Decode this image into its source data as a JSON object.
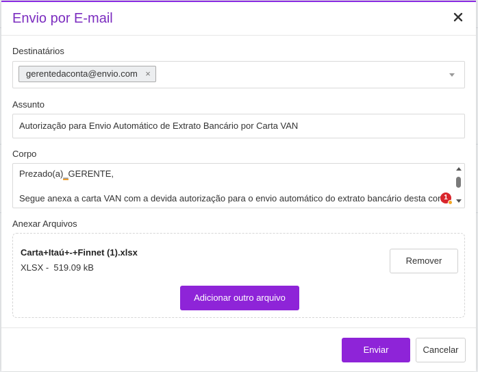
{
  "modal": {
    "title": "Envio por E-mail",
    "close_icon": "close-icon"
  },
  "recipients": {
    "label": "Destinatários",
    "tags": [
      {
        "email": "gerentedaconta@envio.com",
        "remove": "×"
      }
    ],
    "dropdown_icon": "chevron-down-icon"
  },
  "subject": {
    "label": "Assunto",
    "value": "Autorização para Envio Automático de Extrato Bancário por Carta VAN"
  },
  "body": {
    "label": "Corpo",
    "greeting_prefix": "Prezado(a)",
    "greeting_mark": "_",
    "greeting_suffix": "GERENTE,",
    "line2": "Segue anexa a carta VAN com a devida autorização para o envio automático do extrato bancário desta conta.",
    "badge_count": "1"
  },
  "attachments": {
    "label": "Anexar Arquivos",
    "files": [
      {
        "name": "Carta+Itaú+-+Finnet (1).xlsx",
        "type": "XLSX -",
        "size": "519.09 kB"
      }
    ],
    "remove_label": "Remover",
    "add_label": "Adicionar outro arquivo"
  },
  "footer": {
    "send_label": "Enviar",
    "cancel_label": "Cancelar"
  },
  "colors": {
    "accent": "#8e24d8",
    "title": "#7b2cbf",
    "badge": "#d9262c"
  }
}
